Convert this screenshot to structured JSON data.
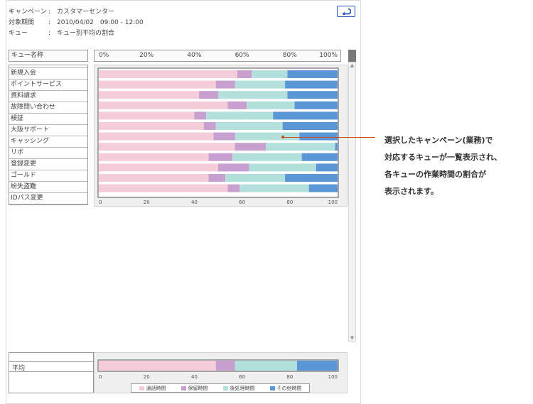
{
  "header": {
    "rows": [
      {
        "key": "キャンペーン",
        "value": "カスタマーセンター"
      },
      {
        "key": "対象期間",
        "value": "2010/04/02　09:00 - 12:00"
      },
      {
        "key": "キュー",
        "value": "キュー別平均の割合"
      }
    ],
    "separator": ":"
  },
  "table": {
    "queue_header": "キュー名称",
    "percent_ticks": [
      "0%",
      "20%",
      "40%",
      "60%",
      "80%",
      "100%"
    ],
    "number_ticks": [
      "0",
      "20",
      "40",
      "60",
      "80",
      "100"
    ],
    "average_label": "平均"
  },
  "chart_data": {
    "type": "bar",
    "orientation": "horizontal",
    "stacked": true,
    "xlim": [
      0,
      100
    ],
    "categories": [
      "新規入会",
      "ポイントサービス",
      "資料請求",
      "故障問い合わせ",
      "検証",
      "大阪サポート",
      "キャッシング",
      "リボ",
      "登録変更",
      "ゴールド",
      "紛失盗難",
      "IDパス変更"
    ],
    "series": [
      {
        "name": "通話時間",
        "color": "#f5ccd9",
        "values": [
          58,
          49,
          42,
          54,
          40,
          44,
          48,
          57,
          46,
          50,
          46,
          54
        ]
      },
      {
        "name": "保留時間",
        "color": "#c8a0cf",
        "values": [
          6,
          8,
          8,
          8,
          5,
          5,
          9,
          13,
          10,
          13,
          7,
          5
        ]
      },
      {
        "name": "後処理時間",
        "color": "#b3e0dc",
        "values": [
          15,
          21,
          29,
          20,
          28,
          28,
          27,
          29,
          29,
          28,
          25,
          29
        ]
      },
      {
        "name": "その他時間",
        "color": "#5b97d6",
        "values": [
          21,
          22,
          21,
          18,
          27,
          23,
          16,
          1,
          15,
          9,
          22,
          12
        ]
      }
    ],
    "average": [
      49,
      8,
      26,
      17
    ]
  },
  "callout": {
    "lines": [
      "選択したキャンペーン(業務)で",
      "対応するキューが一覧表示され、",
      "各キューの作業時間の割合が",
      "表示されます。"
    ]
  }
}
